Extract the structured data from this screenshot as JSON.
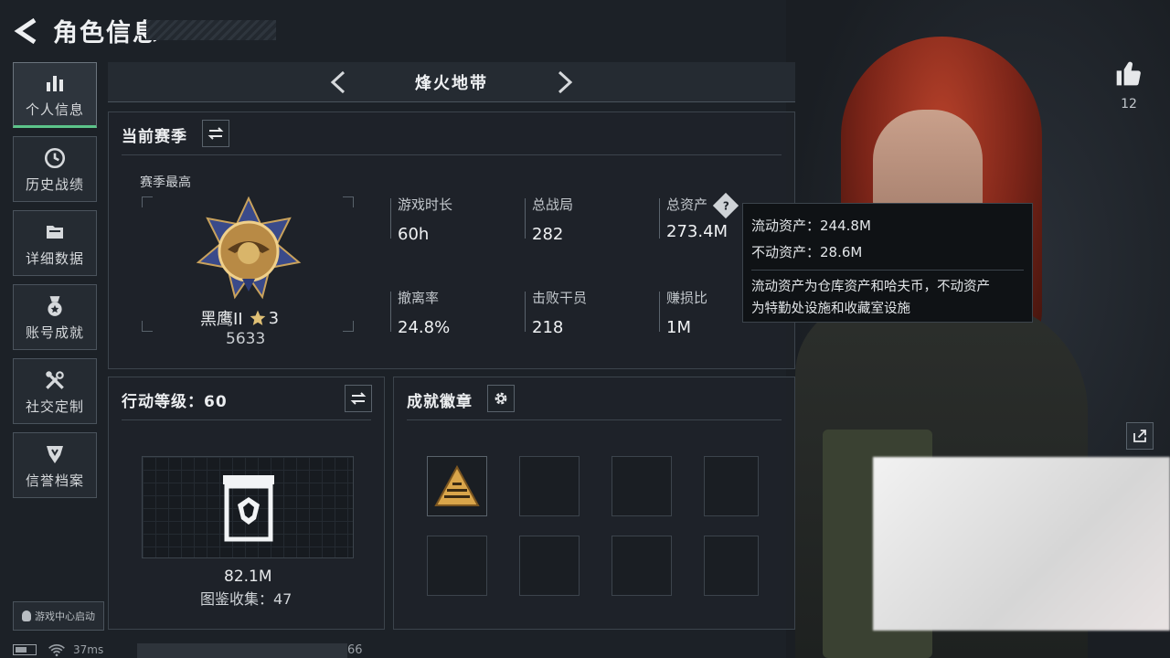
{
  "header": {
    "title": "角色信息"
  },
  "sidebar": {
    "items": [
      {
        "label": "个人信息",
        "icon": "bar-chart-icon",
        "active": true
      },
      {
        "label": "历史战绩",
        "icon": "history-clock-icon",
        "active": false
      },
      {
        "label": "详细数据",
        "icon": "folder-icon",
        "active": false
      },
      {
        "label": "账号成就",
        "icon": "medal-icon",
        "active": false
      },
      {
        "label": "社交定制",
        "icon": "tools-icon",
        "active": false
      },
      {
        "label": "信誉档案",
        "icon": "shield-badge-icon",
        "active": false
      }
    ],
    "game_center_label": "游戏中心启动"
  },
  "status": {
    "ping": "37ms",
    "ping_right": "66"
  },
  "mode": {
    "label": "烽火地带"
  },
  "season": {
    "title": "当前赛季",
    "best_label": "赛季最高",
    "rank_name": "黑鹰II",
    "rank_stars": "3",
    "rank_score": "5633",
    "stats": [
      {
        "label": "游戏时长",
        "value": "60h"
      },
      {
        "label": "总战局",
        "value": "282"
      },
      {
        "label": "总资产",
        "value": "273.4M"
      },
      {
        "label": "撤离率",
        "value": "24.8%"
      },
      {
        "label": "击败干员",
        "value": "218"
      },
      {
        "label": "赚损比",
        "value": "1M"
      }
    ]
  },
  "tooltip": {
    "liquid": "流动资产：244.8M",
    "fixed": "不动资产：28.6M",
    "note_line1": "流动资产为仓库资产和哈夫币，不动资产",
    "note_line2": "为特勤处设施和收藏室设施"
  },
  "action_level": {
    "title": "行动等级：60",
    "value": "82.1M",
    "collection": "图鉴收集：47"
  },
  "badges": {
    "title": "成就徽章"
  },
  "likes": {
    "count": "12"
  },
  "colors": {
    "accent_green": "#5cc48a",
    "panel_bg": "#1e2329",
    "border": "#3c444c"
  }
}
